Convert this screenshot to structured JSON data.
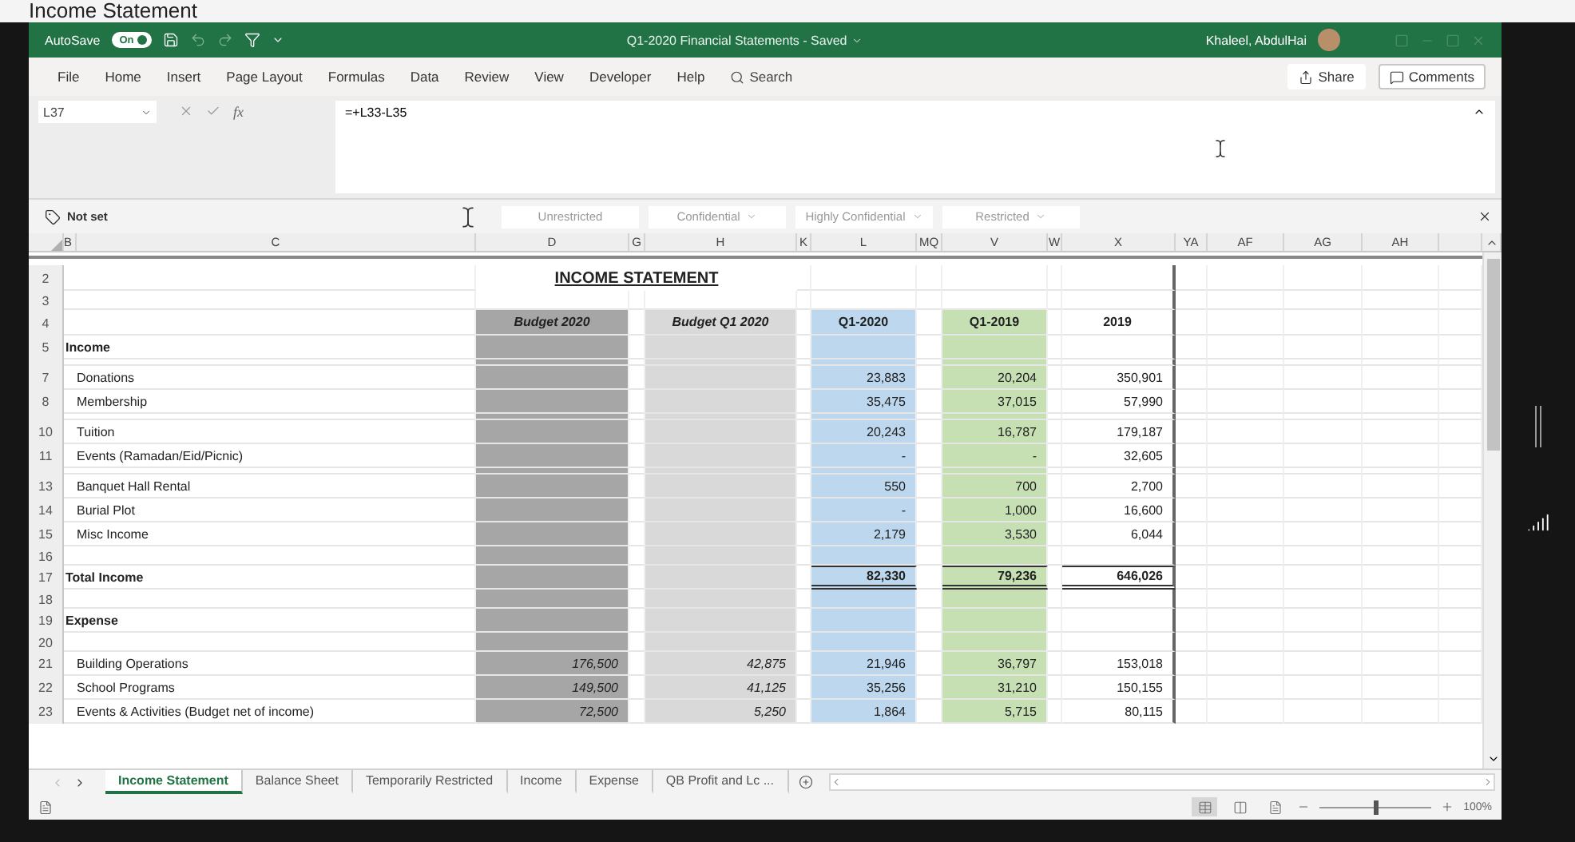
{
  "page_title": "Income Statement",
  "title_bar": {
    "autosave_label": "AutoSave",
    "autosave": {
      "label": "On",
      "on": true
    },
    "document_title": "Q1-2020 Financial Statements - Saved",
    "user": "Khaleel, AbdulHai"
  },
  "ribbon_tabs": [
    "File",
    "Home",
    "Insert",
    "Page Layout",
    "Formulas",
    "Data",
    "Review",
    "View",
    "Developer",
    "Help"
  ],
  "search": {
    "placeholder": "Search"
  },
  "share": "Share",
  "comments": "Comments",
  "name_box": "L37",
  "function_label": "fx",
  "formula": "=+L33-L35",
  "sensitivity": {
    "current": "Not set",
    "labels": [
      {
        "label": "Unrestricted",
        "dropdown": false
      },
      {
        "label": "Confidential",
        "dropdown": true
      },
      {
        "label": "Highly Confidential",
        "dropdown": true
      },
      {
        "label": "Restricted",
        "dropdown": true
      }
    ]
  },
  "column_headers": [
    "B",
    "C",
    "D",
    "G",
    "H",
    "K",
    "L",
    "MQ",
    "V",
    "W",
    "X",
    "YA",
    "AF",
    "AG",
    "AH"
  ],
  "sheet": {
    "title": "INCOME STATEMENT",
    "headers": {
      "budget_2020": "Budget 2020",
      "budget_q1_2020": "Budget Q1 2020",
      "q1_2020": "Q1-2020",
      "q1_2019": "Q1-2019",
      "y2019": "2019"
    },
    "rows": [
      {
        "kind": "title",
        "number": "2"
      },
      {
        "kind": "blank",
        "number": "3"
      },
      {
        "kind": "header",
        "number": "4"
      },
      {
        "kind": "section",
        "number": "5",
        "label": "Income"
      },
      {
        "kind": "hidden"
      },
      {
        "kind": "item",
        "number": "7",
        "label": "Donations",
        "values": {
          "q1_2020": "23,883",
          "q1_2019": "20,204",
          "y2019": "350,901"
        }
      },
      {
        "kind": "item",
        "number": "8",
        "label": "Membership",
        "values": {
          "q1_2020": "35,475",
          "q1_2019": "37,015",
          "y2019": "57,990"
        }
      },
      {
        "kind": "hidden"
      },
      {
        "kind": "item",
        "number": "10",
        "label": "Tuition",
        "values": {
          "q1_2020": "20,243",
          "q1_2019": "16,787",
          "y2019": "179,187"
        }
      },
      {
        "kind": "item",
        "number": "11",
        "label": "Events (Ramadan/Eid/Picnic)",
        "values": {
          "q1_2020": "-",
          "q1_2019": "-",
          "y2019": "32,605"
        }
      },
      {
        "kind": "hidden"
      },
      {
        "kind": "item",
        "number": "13",
        "label": "Banquet Hall Rental",
        "values": {
          "q1_2020": "550",
          "q1_2019": "700",
          "y2019": "2,700"
        }
      },
      {
        "kind": "item",
        "number": "14",
        "label": "Burial Plot",
        "values": {
          "q1_2020": "-",
          "q1_2019": "1,000",
          "y2019": "16,600"
        }
      },
      {
        "kind": "item",
        "number": "15",
        "label": "Misc Income",
        "values": {
          "q1_2020": "2,179",
          "q1_2019": "3,530",
          "y2019": "6,044"
        }
      },
      {
        "kind": "blank",
        "number": "16"
      },
      {
        "kind": "total",
        "number": "17",
        "label": "Total Income",
        "values": {
          "q1_2020": "82,330",
          "q1_2019": "79,236",
          "y2019": "646,026"
        }
      },
      {
        "kind": "blank",
        "number": "18"
      },
      {
        "kind": "section",
        "number": "19",
        "label": "Expense"
      },
      {
        "kind": "blank",
        "number": "20"
      },
      {
        "kind": "item",
        "number": "21",
        "label": "Building Operations",
        "values": {
          "budget_2020": "176,500",
          "budget_q1_2020": "42,875",
          "q1_2020": "21,946",
          "q1_2019": "36,797",
          "y2019": "153,018"
        }
      },
      {
        "kind": "item",
        "number": "22",
        "label": "School Programs",
        "values": {
          "budget_2020": "149,500",
          "budget_q1_2020": "41,125",
          "q1_2020": "35,256",
          "q1_2019": "31,210",
          "y2019": "150,155"
        }
      },
      {
        "kind": "item",
        "number": "23",
        "label": "Events & Activities (Budget net of income)",
        "values": {
          "budget_2020": "72,500",
          "budget_q1_2020": "5,250",
          "q1_2020": "1,864",
          "q1_2019": "5,715",
          "y2019": "80,115"
        }
      }
    ]
  },
  "sheet_tabs": [
    {
      "label": "Income Statement",
      "selected": true
    },
    {
      "label": "Balance Sheet",
      "selected": false
    },
    {
      "label": "Temporarily Restricted",
      "selected": false
    },
    {
      "label": "Income",
      "selected": false
    },
    {
      "label": "Expense",
      "selected": false
    },
    {
      "label": "QB Profit and Lc ...",
      "selected": false
    }
  ],
  "zoom": {
    "label": "100%",
    "level": 0.5
  }
}
